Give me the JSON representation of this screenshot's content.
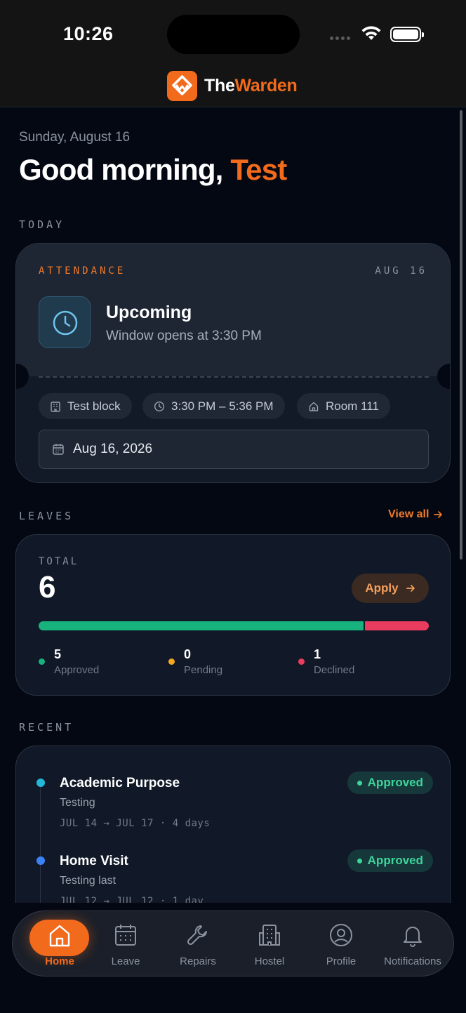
{
  "status_bar": {
    "time": "10:26"
  },
  "header": {
    "brand_prefix": "The",
    "brand_suffix": "Warden"
  },
  "greeting": {
    "date": "Sunday, August 16",
    "prefix": "Good morning, ",
    "name": "Test"
  },
  "today": {
    "section_label": "TODAY",
    "attendance": {
      "label": "ATTENDANCE",
      "date": "AUG 16",
      "status": "Upcoming",
      "subtitle": "Window opens at 3:30 PM",
      "block": "Test block",
      "time_range": "3:30 PM – 5:36 PM",
      "room": "Room 111",
      "date_field": "Aug 16, 2026"
    }
  },
  "leaves": {
    "section_label": "LEAVES",
    "view_all": "View all",
    "total_label": "TOTAL",
    "total": "6",
    "apply_label": "Apply",
    "stats": [
      {
        "count": "5",
        "label": "Approved",
        "color": "#17b27d"
      },
      {
        "count": "0",
        "label": "Pending",
        "color": "#f5a623"
      },
      {
        "count": "1",
        "label": "Declined",
        "color": "#ea3c5f"
      }
    ],
    "approved_fraction": 0.833
  },
  "recent": {
    "section_label": "RECENT",
    "items": [
      {
        "title": "Academic Purpose",
        "note": "Testing",
        "meta": "JUL 14 → JUL 17 · 4 days",
        "status": "Approved",
        "bullet_color": "#22b8d8"
      },
      {
        "title": "Home Visit",
        "note": "Testing last",
        "meta": "JUL 12 → JUL 12 · 1 day",
        "status": "Approved",
        "bullet_color": "#3b82f6"
      }
    ]
  },
  "nav": {
    "tabs": [
      {
        "label": "Home",
        "icon": "home-icon",
        "active": true
      },
      {
        "label": "Leave",
        "icon": "calendar-icon"
      },
      {
        "label": "Repairs",
        "icon": "wrench-icon"
      },
      {
        "label": "Hostel",
        "icon": "building-icon"
      },
      {
        "label": "Profile",
        "icon": "user-circle-icon"
      },
      {
        "label": "Notifications",
        "icon": "bell-icon"
      }
    ]
  },
  "colors": {
    "accent": "#f26a1b",
    "background": "#040813",
    "approved": "#17b27d",
    "declined": "#ea3c5f"
  }
}
